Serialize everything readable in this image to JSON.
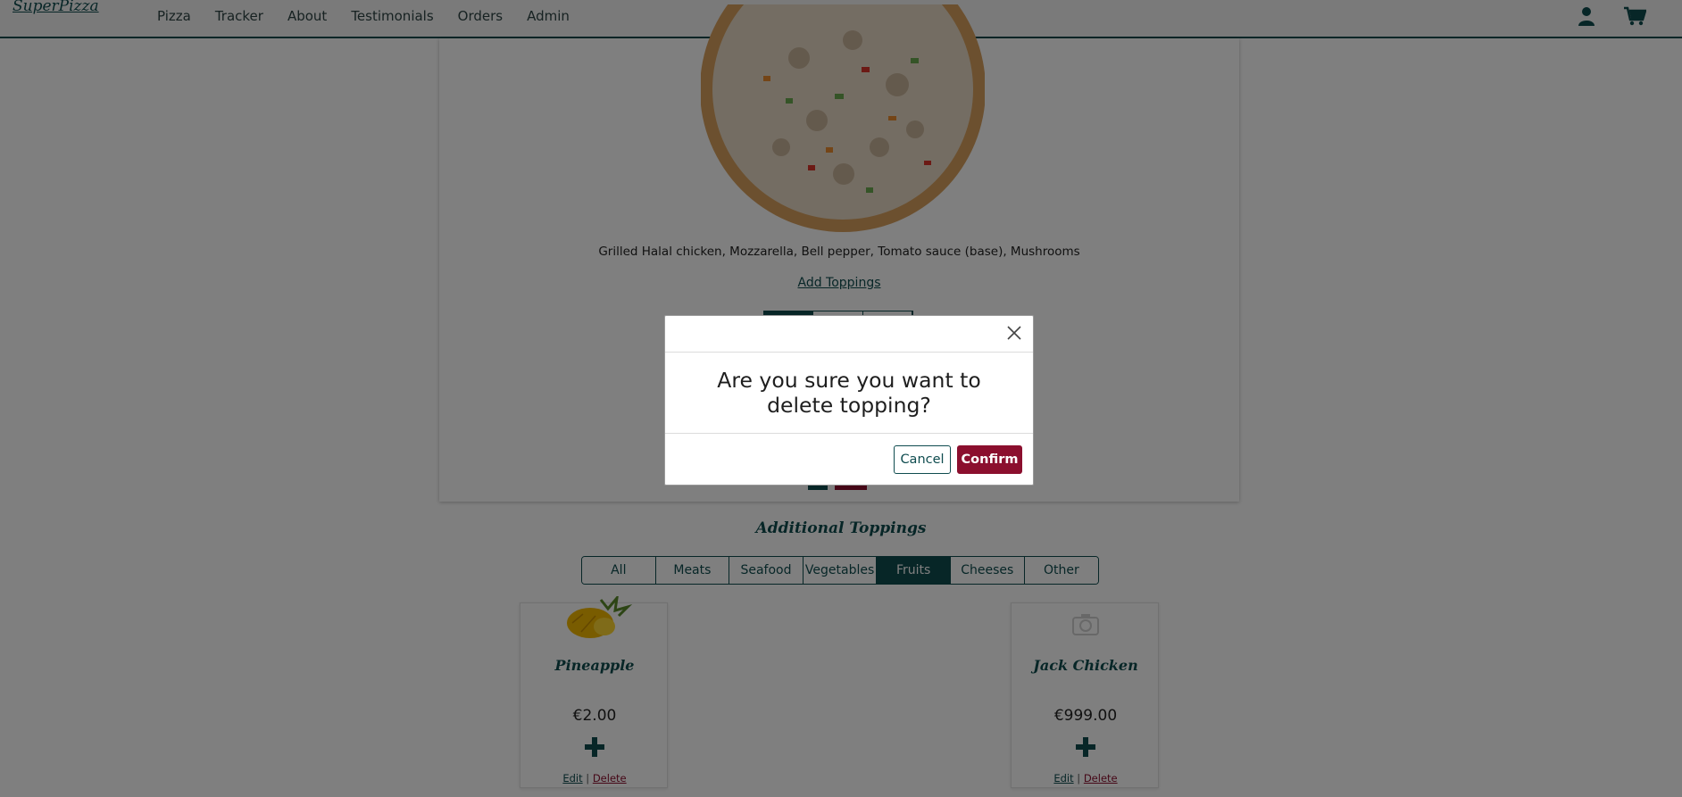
{
  "navbar": {
    "brand": "SuperPizza",
    "links": [
      "Pizza",
      "Tracker",
      "About",
      "Testimonials",
      "Orders",
      "Admin"
    ],
    "icons": [
      "user-icon",
      "cart-icon"
    ]
  },
  "pizza": {
    "description": "Grilled Halal chicken, Mozzarella, Bell pepper, Tomato sauce (base), Mushrooms",
    "add_toppings": "Add Toppings"
  },
  "additional": {
    "title": "Additional Toppings",
    "tabs": [
      "All",
      "Meats",
      "Seafood",
      "Vegetables",
      "Fruits",
      "Cheeses",
      "Other"
    ],
    "active_tab": "Fruits",
    "cards": [
      {
        "name": "Pineapple",
        "price": "€2.00",
        "edit": "Edit",
        "separator": "|",
        "delete": "Delete",
        "image": "pineapple-image"
      },
      {
        "name": "Jack Chicken",
        "price": "€999.00",
        "edit": "Edit",
        "separator": "|",
        "delete": "Delete",
        "image": "camera-placeholder-icon"
      }
    ]
  },
  "modal": {
    "message": "Are you sure you want to delete topping?",
    "cancel_label": "Cancel",
    "confirm_label": "Confirm"
  },
  "colors": {
    "primary": "#0f4c4f",
    "danger": "#8b0f2e",
    "overlay": "rgba(0,0,0,0.5)"
  }
}
